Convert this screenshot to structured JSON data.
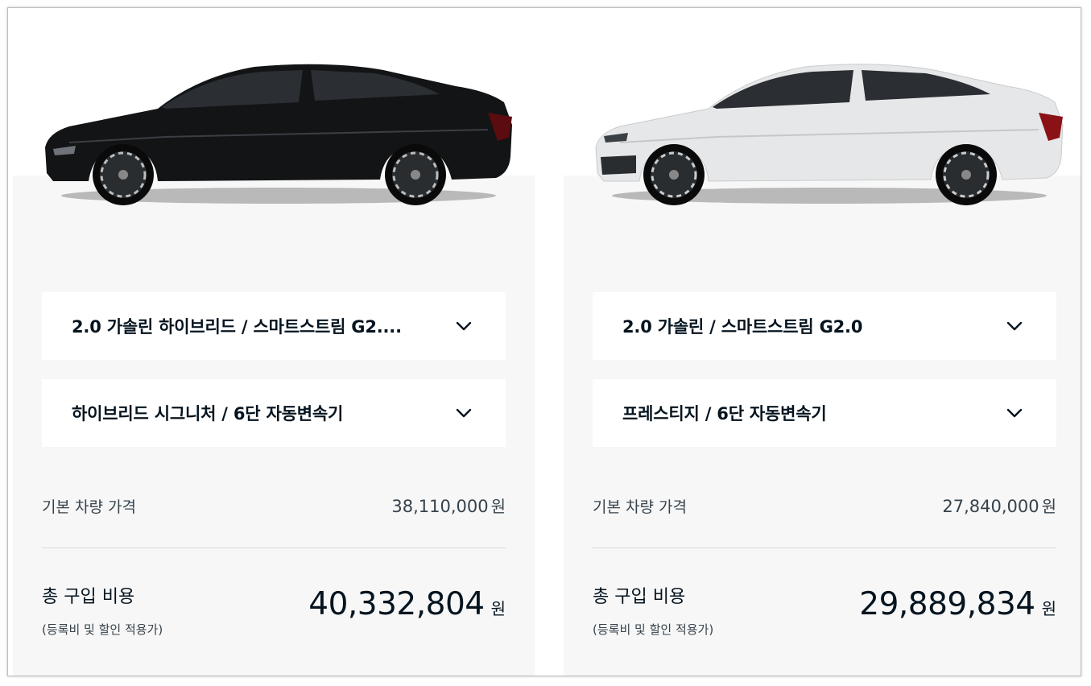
{
  "left": {
    "engine": "2.0 가솔린 하이브리드 / 스마트스트림 G2....",
    "trim": "하이브리드 시그니처 / 6단 자동변속기",
    "base_price_label": "기본 차량 가격",
    "base_price": "38,110,000",
    "base_price_unit": "원",
    "total_label": "총 구입 비용",
    "total_note": "(등록비 및 할인 적용가)",
    "total_price": "40,332,804",
    "total_unit": "원",
    "car_color": "#111315"
  },
  "right": {
    "engine": "2.0 가솔린 / 스마트스트림 G2.0",
    "trim": "프레스티지 / 6단 자동변속기",
    "base_price_label": "기본 차량 가격",
    "base_price": "27,840,000",
    "base_price_unit": "원",
    "total_label": "총 구입 비용",
    "total_note": "(등록비 및 할인 적용가)",
    "total_price": "29,889,834",
    "total_unit": "원",
    "car_color": "#e9eaeb"
  },
  "icons": {
    "dropdown": "chevron-down-icon"
  }
}
